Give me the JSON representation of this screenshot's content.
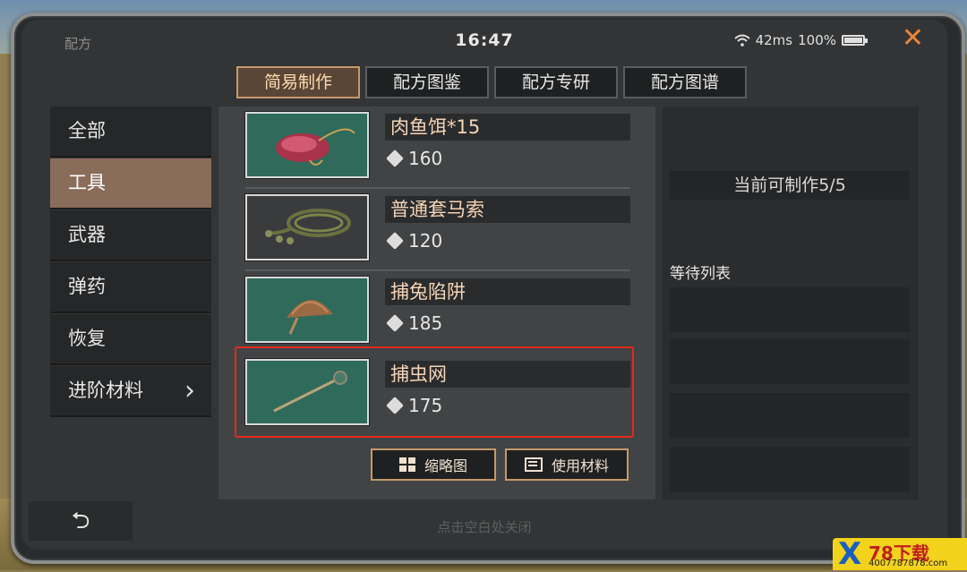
{
  "status": {
    "title": "配方",
    "time": "16:47",
    "ping": "42ms",
    "battery": "100%",
    "close_icon": "✕"
  },
  "tabs": [
    {
      "label": "简易制作",
      "active": true
    },
    {
      "label": "配方图鉴",
      "active": false
    },
    {
      "label": "配方专研",
      "active": false
    },
    {
      "label": "配方图谱",
      "active": false
    }
  ],
  "categories": [
    {
      "label": "全部"
    },
    {
      "label": "工具"
    },
    {
      "label": "武器"
    },
    {
      "label": "弹药"
    },
    {
      "label": "恢复"
    },
    {
      "label": "进阶材料"
    }
  ],
  "items": [
    {
      "name": "肉鱼饵*15",
      "cost": "160",
      "icon": "meat-bait-icon"
    },
    {
      "name": "普通套马索",
      "cost": "120",
      "icon": "lasso-icon"
    },
    {
      "name": "捕兔陷阱",
      "cost": "185",
      "icon": "rabbit-trap-icon"
    },
    {
      "name": "捕虫网",
      "cost": "175",
      "icon": "bug-net-icon"
    }
  ],
  "buttons": {
    "thumbnail": "缩略图",
    "materials": "使用材料"
  },
  "right": {
    "craftable": "当前可制作5/5",
    "waiting_title": "等待列表"
  },
  "hint": "点击空白处关闭",
  "watermark": {
    "brand": "78下载",
    "url": "4007787878.com"
  },
  "colors": {
    "accent": "#c49a6c",
    "selection": "#e02a20",
    "close": "#e8863a"
  }
}
